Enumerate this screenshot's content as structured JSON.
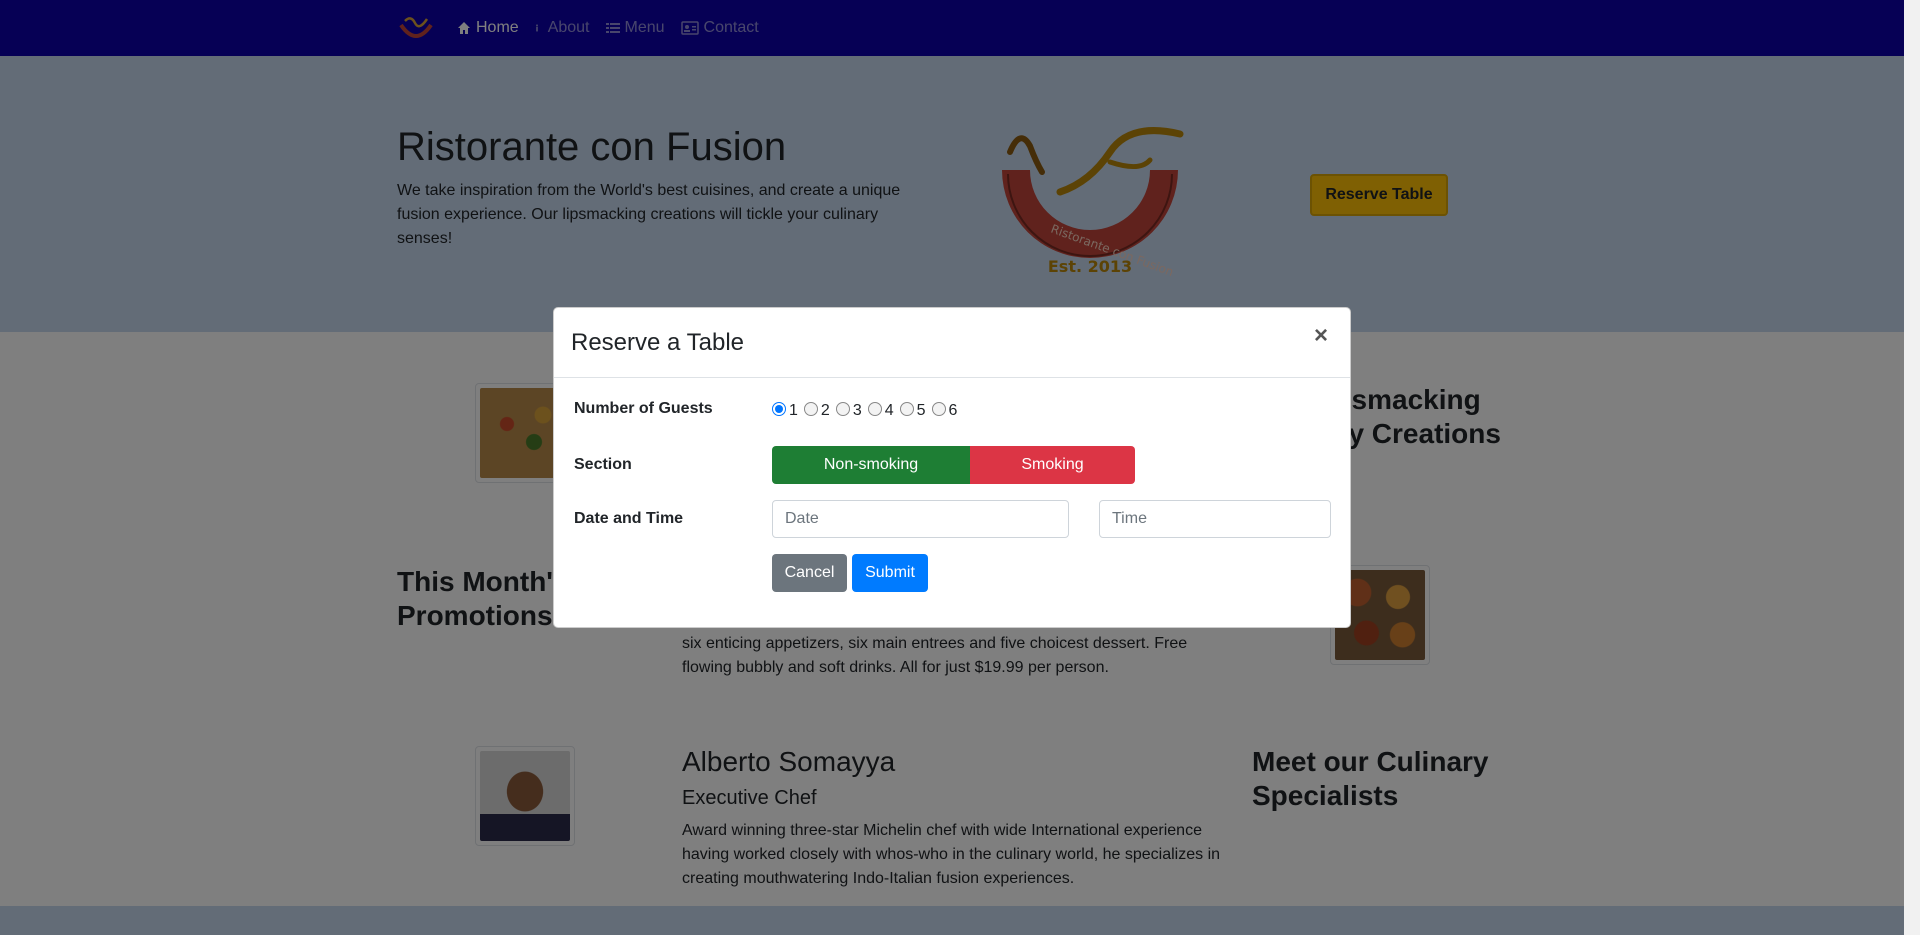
{
  "colors": {
    "navbar": "#0d00aa",
    "jumbotron": "#c7d9ef",
    "accent_yellow": "#ffc107",
    "success": "#1e7e34",
    "danger": "#dc3545",
    "primary": "#007bff",
    "secondary": "#6c757d"
  },
  "nav": {
    "items": [
      {
        "label": "Home",
        "icon": "home-icon",
        "active": true
      },
      {
        "label": "About",
        "icon": "info-icon",
        "active": false
      },
      {
        "label": "Menu",
        "icon": "list-icon",
        "active": false
      },
      {
        "label": "Contact",
        "icon": "address-card-icon",
        "active": false
      }
    ]
  },
  "jumbotron": {
    "title": "Ristorante con Fusion",
    "text": "We take inspiration from the World's best cuisines, and create a unique fusion experience. Our lipsmacking creations will tickle your culinary senses!",
    "logo_text": "Ristorante con Fusion",
    "logo_est": "Est. 2013",
    "reserve_label": "Reserve Table"
  },
  "sections": {
    "creations_heading_line1": "Our Lipsmacking",
    "creations_heading_line2": "Culinary Creations",
    "promotions_heading_line1": "This Month's",
    "promotions_heading_line2": "Promotions",
    "promo_text": "six enticing appetizers, six main entrees and five choicest dessert. Free flowing bubbly and soft drinks. All for just $19.99 per person.",
    "specialists_heading_line1": "Meet our Culinary",
    "specialists_heading_line2": "Specialists",
    "chef_name": "Alberto Somayya",
    "chef_title": "Executive Chef",
    "chef_text": "Award winning three-star Michelin chef with wide International experience having worked closely with whos-who in the culinary world, he specializes in creating mouthwatering Indo-Italian fusion experiences."
  },
  "modal": {
    "title": "Reserve a Table",
    "close": "×",
    "guests_label": "Number of Guests",
    "guests": [
      "1",
      "2",
      "3",
      "4",
      "5",
      "6"
    ],
    "guests_selected": "1",
    "section_label": "Section",
    "section_nonsmoking": "Non-smoking",
    "section_smoking": "Smoking",
    "datetime_label": "Date and Time",
    "date_placeholder": "Date",
    "time_placeholder": "Time",
    "cancel": "Cancel",
    "submit": "Submit"
  }
}
